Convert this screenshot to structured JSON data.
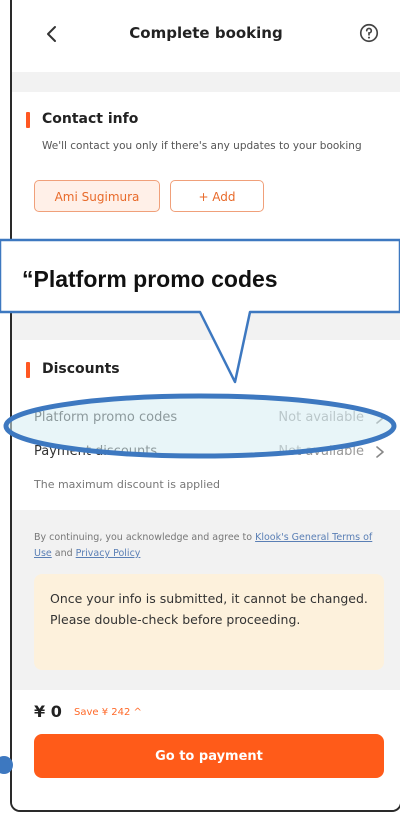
{
  "header": {
    "title": "Complete booking",
    "back_icon": "chevron-left-icon",
    "help_icon": "help-circle-icon"
  },
  "contact": {
    "title": "Contact info",
    "description": "We'll contact you only if there's any updates to your booking",
    "selected_contact": "Ami Sugimura",
    "add_label": "+ Add"
  },
  "callout": {
    "text": "“Platform promo codes"
  },
  "discounts": {
    "title": "Discounts",
    "rows": [
      {
        "label": "Platform promo codes",
        "value": "Not available"
      },
      {
        "label": "Payment discounts",
        "value": "Not available"
      }
    ],
    "note": "The maximum discount is applied"
  },
  "terms": {
    "prefix": "By continuing, you acknowledge and agree to ",
    "link1": "Klook's General Terms of Use",
    "middle": " and ",
    "link2": "Privacy Policy"
  },
  "notice": {
    "text": "Once your info is submitted, it cannot be changed. Please double-check before proceeding."
  },
  "footer": {
    "price": "¥ 0",
    "save": "Save ¥ 242 ^",
    "pay_label": "Go to payment"
  },
  "colors": {
    "accent": "#ff5722",
    "annotation_blue": "#3d78c0",
    "annotation_fill": "#d5edf3"
  }
}
